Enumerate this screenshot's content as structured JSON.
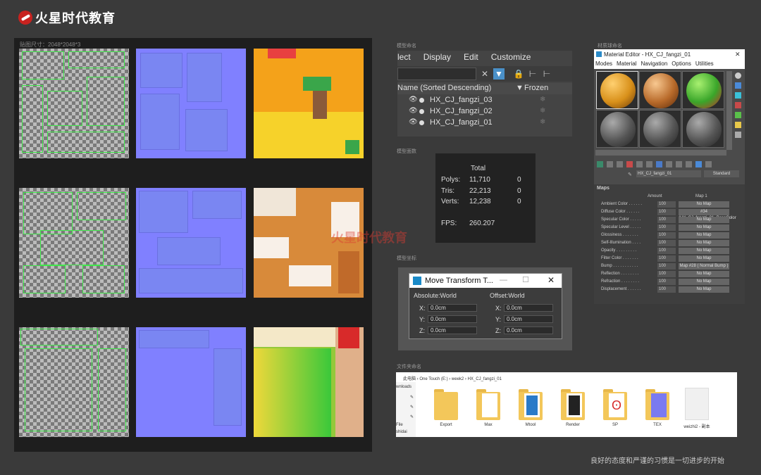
{
  "brand": {
    "name": "火星时代教育",
    "watermark": "火星时代教育"
  },
  "texture_panel": {
    "label": "贴图尺寸：2048*2048*3"
  },
  "captions": {
    "scene_explorer": "模型命名",
    "stats": "模型面数",
    "transform": "模型坐标",
    "material_editor": "材质球命名",
    "files": "文件夹命名"
  },
  "scene_explorer": {
    "menu": [
      "lect",
      "Display",
      "Edit",
      "Customize"
    ],
    "columns": {
      "name": "Name (Sorted Descending)",
      "frozen": "Frozen"
    },
    "rows": [
      "HX_CJ_fangzi_03",
      "HX_CJ_fangzi_02",
      "HX_CJ_fangzi_01"
    ]
  },
  "stats": {
    "header": "Total",
    "polys_label": "Polys:",
    "polys_total": "11,710",
    "polys_sel": "0",
    "tris_label": "Tris:",
    "tris_total": "22,213",
    "tris_sel": "0",
    "verts_label": "Verts:",
    "verts_total": "12,238",
    "verts_sel": "0",
    "fps_label": "FPS:",
    "fps_value": "260.207"
  },
  "material_editor": {
    "title": "Material Editor - HX_CJ_fangzi_01",
    "menu": [
      "Modes",
      "Material",
      "Navigation",
      "Options",
      "Utilities"
    ],
    "material_name": "HX_CJ_fangzi_01",
    "material_type": "Standard",
    "maps_header": "Maps",
    "amount_header": "Amount",
    "map_header": "Map 1",
    "map_rows": [
      {
        "label": "Ambient Color . . . . . .",
        "amount": "100",
        "map": "No Map"
      },
      {
        "label": "Diffuse Color . . . . . .",
        "amount": "100",
        "map": "#34 (HX_CJ_fangzi_01_BaseColor"
      },
      {
        "label": "Specular Color . . . . .",
        "amount": "100",
        "map": "No Map"
      },
      {
        "label": "Specular Level . . . . .",
        "amount": "100",
        "map": "No Map"
      },
      {
        "label": "Glossiness . . . . . . .",
        "amount": "100",
        "map": "No Map"
      },
      {
        "label": "Self-Illumination . . . .",
        "amount": "100",
        "map": "No Map"
      },
      {
        "label": "Opacity . . . . . . . . .",
        "amount": "100",
        "map": "No Map"
      },
      {
        "label": "Filter Color . . . . . . .",
        "amount": "100",
        "map": "No Map"
      },
      {
        "label": "Bump . . . . . . . . . . .",
        "amount": "100",
        "map": "Map #28 ( Normal Bump )"
      },
      {
        "label": "Reflection . . . . . . . .",
        "amount": "100",
        "map": "No Map"
      },
      {
        "label": "Refraction . . . . . . . .",
        "amount": "100",
        "map": "No Map"
      },
      {
        "label": "Displacement . . . . . .",
        "amount": "100",
        "map": "No Map"
      }
    ]
  },
  "move_transform": {
    "title": "Move Transform T...",
    "absolute_label": "Absolute:World",
    "offset_label": "Offset:World",
    "abs": {
      "x_label": "X:",
      "x": "0.0cm",
      "y_label": "Y:",
      "y": "0.0cm",
      "z_label": "Z:",
      "z": "0.0cm"
    },
    "off": {
      "x_label": "X:",
      "x": "0.0cm",
      "y_label": "Y:",
      "y": "0.0cm",
      "z_label": "Z:",
      "z": "0.0cm"
    }
  },
  "files": {
    "breadcrumb": "此电脑 › One Touch (E:) › week2 › HX_CJ_fangzi_01",
    "side_labels": [
      "wnloads",
      "File",
      "shidai"
    ],
    "folders": [
      "Export",
      "Max",
      "Mtool",
      "Render",
      "SP",
      "TEX",
      "weizhi2 - 副本"
    ]
  },
  "slogan": "良好的态度和严谨的习惯是一切进步的开始"
}
